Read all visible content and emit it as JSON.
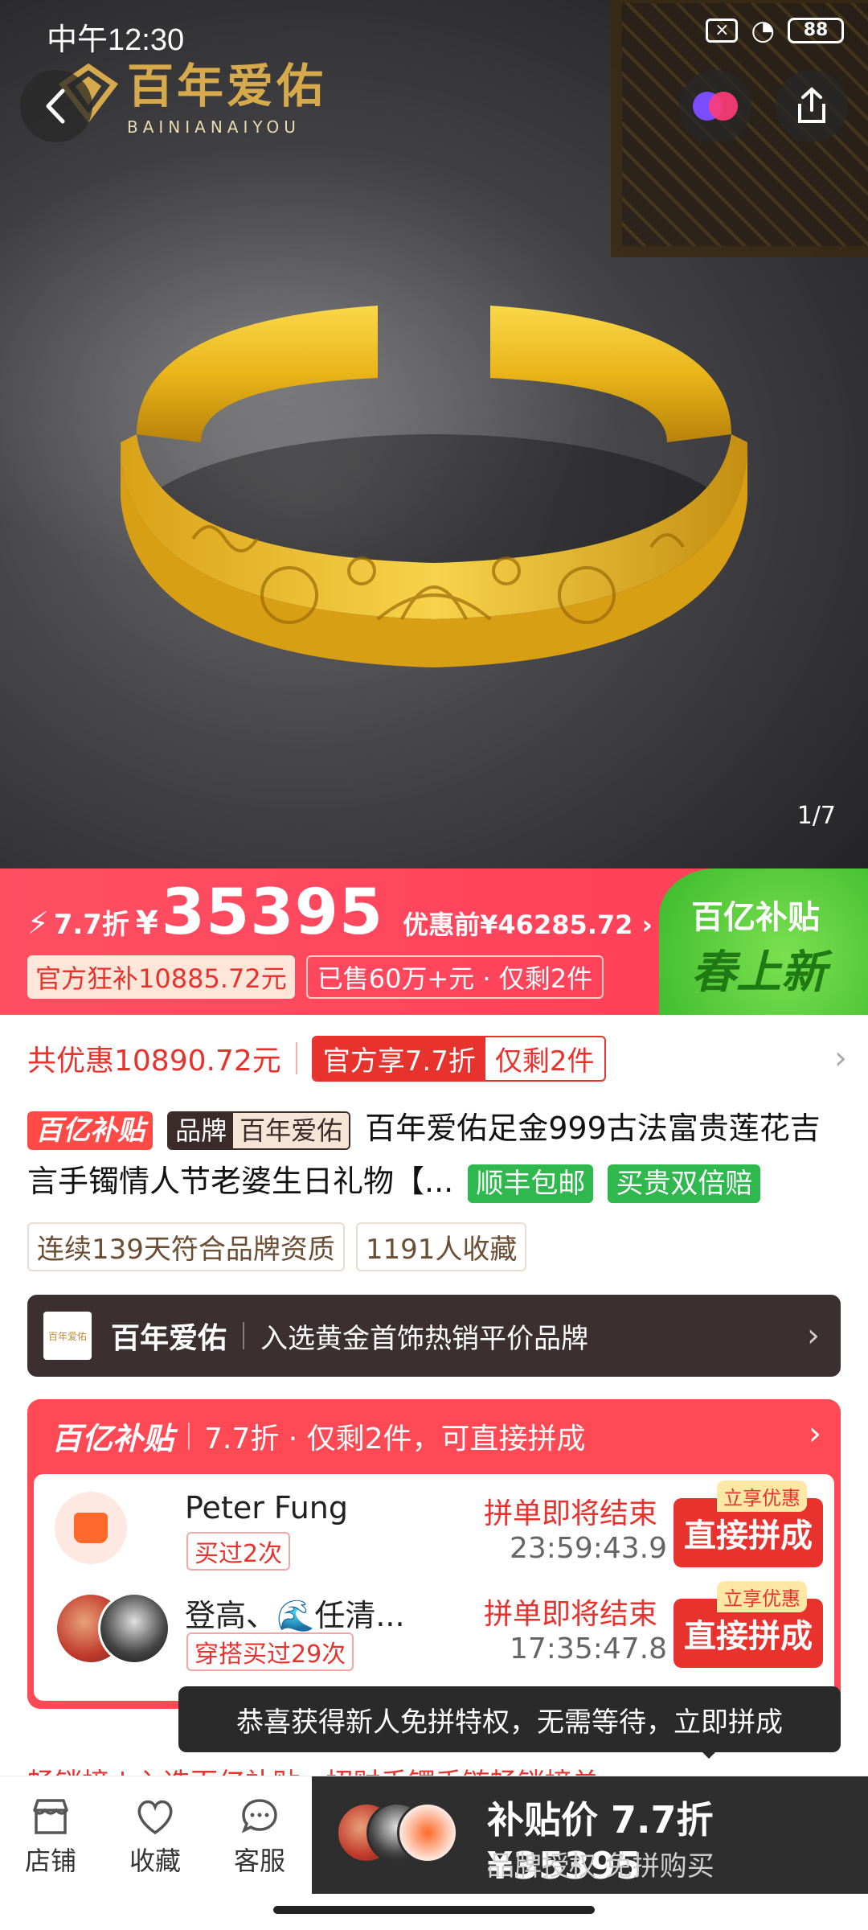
{
  "status": {
    "time": "中午12:30",
    "battery": "88"
  },
  "brand_logo": {
    "cn": "百年爱佑",
    "en": "BAINIANAIYOU"
  },
  "gallery": {
    "indicator": "1/7"
  },
  "price_banner": {
    "discount": "7.7折",
    "currency": "¥",
    "price": "35395",
    "before": "优惠前¥46285.72",
    "subsidy": "官方狂补10885.72元",
    "sold": "已售60万+元 · 仅剩2件",
    "badge_line1": "百亿补贴",
    "badge_line2": "春上新"
  },
  "discount_line": {
    "total": "共优惠10890.72元",
    "official": "官方享7.7折",
    "remaining": "仅剩2件"
  },
  "product": {
    "subsidy_tag": "百亿补贴",
    "brand_label": "品牌",
    "brand_name": "百年爱佑",
    "title": "百年爱佑足金999古法富贵莲花吉言手镯情人节老婆生日礼物【...",
    "tag_shipping": "顺丰包邮",
    "tag_guarantee": "买贵双倍赔"
  },
  "info_tags": [
    "连续139天符合品牌资质",
    "1191人收藏"
  ],
  "brand_bar": {
    "logo_text": "百年爱佑",
    "name": "百年爱佑",
    "desc": "入选黄金首饰热销平价品牌"
  },
  "group_buy": {
    "header_logo": "百亿补贴",
    "header_text": "7.7折 · 仅剩2件，可直接拼成",
    "rows": [
      {
        "user": "Peter Fung",
        "bought": "买过2次",
        "ending": "拼单即将结束",
        "timer": "23:59:43.9",
        "join": "直接拼成",
        "hint": "立享优惠"
      },
      {
        "user": "登高、🌊任清...",
        "bought": "穿搭买过29次",
        "ending": "拼单即将结束",
        "timer": "17:35:47.8",
        "join": "直接拼成",
        "hint": "立享优惠"
      }
    ]
  },
  "toast": "恭喜获得新人免拼特权，无需等待，立即拼成",
  "peek_text": "畅销榜 | 入选百亿补贴 · 招财手镯手链畅销榜单",
  "bottom_bar": {
    "tabs": [
      {
        "label": "店铺",
        "icon": "store-icon"
      },
      {
        "label": "收藏",
        "icon": "heart-icon"
      },
      {
        "label": "客服",
        "icon": "chat-icon"
      }
    ],
    "buy_main": "补贴价 7.7折 ¥35395",
    "buy_sub": "品牌授权 免拼购买"
  },
  "colors": {
    "accent": "#ff4a55",
    "price_red": "#e8322e",
    "gold": "#d6a94c",
    "green": "#2fb84d"
  }
}
